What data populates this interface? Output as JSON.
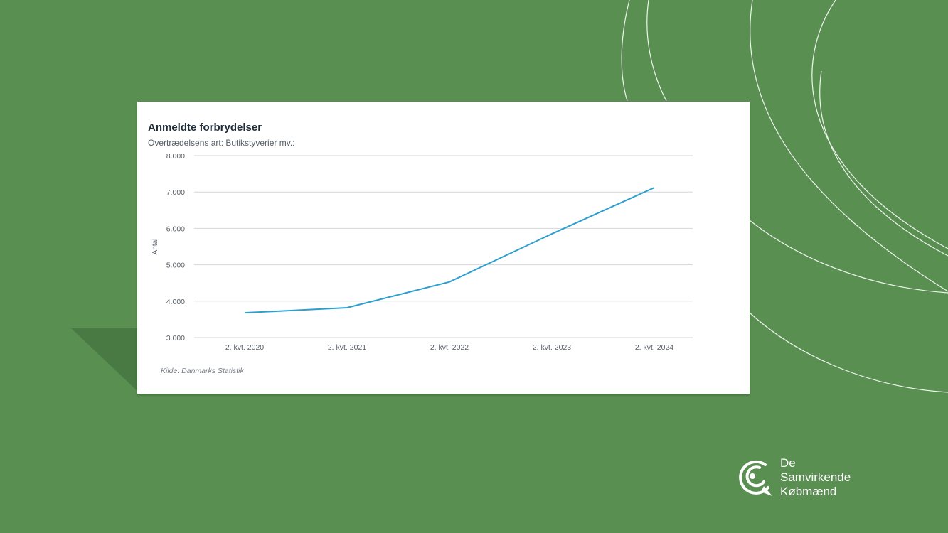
{
  "colors": {
    "background": "#5a8f52",
    "card": "#ffffff",
    "line": "#2c9fcf",
    "grid": "#d4d6d9"
  },
  "chart_data": {
    "type": "line",
    "title": "Anmeldte forbrydelser",
    "subtitle": "Overtrædelsens art: Butikstyverier mv.:",
    "ylabel": "Antal",
    "xlabel": "",
    "source": "Kilde: Danmarks Statistik",
    "ylim": [
      3000,
      8000
    ],
    "yticks": [
      3000,
      4000,
      5000,
      6000,
      7000,
      8000
    ],
    "ytick_labels": [
      "3.000",
      "4.000",
      "5.000",
      "6.000",
      "7.000",
      "8.000"
    ],
    "categories": [
      "2. kvt. 2020",
      "2. kvt. 2021",
      "2. kvt. 2022",
      "2. kvt. 2023",
      "2. kvt. 2024"
    ],
    "series": [
      {
        "values": [
          3680,
          3820,
          4530,
          5850,
          7120
        ]
      }
    ],
    "grid": true,
    "legend": false
  },
  "logo": {
    "line1": "De",
    "line2": "Samvirkende",
    "line3": "Købmænd",
    "icon": "speech-bubble-swirl-icon"
  }
}
